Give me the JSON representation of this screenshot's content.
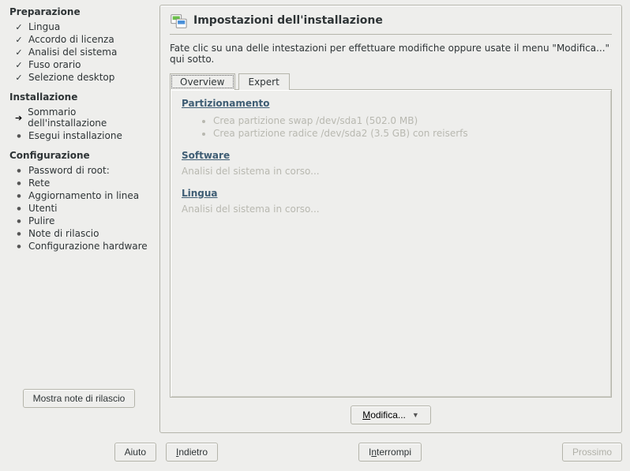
{
  "sidebar": {
    "sections": [
      {
        "title": "Preparazione",
        "items": [
          {
            "label": "Lingua",
            "status": "check"
          },
          {
            "label": "Accordo di licenza",
            "status": "check"
          },
          {
            "label": "Analisi del sistema",
            "status": "check"
          },
          {
            "label": "Fuso orario",
            "status": "check"
          },
          {
            "label": "Selezione desktop",
            "status": "check"
          }
        ]
      },
      {
        "title": "Installazione",
        "items": [
          {
            "label": "Sommario dell'installazione",
            "status": "arrow"
          },
          {
            "label": "Esegui installazione",
            "status": "bullet"
          }
        ]
      },
      {
        "title": "Configurazione",
        "items": [
          {
            "label": "Password di root:",
            "status": "bullet"
          },
          {
            "label": "Rete",
            "status": "bullet"
          },
          {
            "label": "Aggiornamento in linea",
            "status": "bullet"
          },
          {
            "label": "Utenti",
            "status": "bullet"
          },
          {
            "label": "Pulire",
            "status": "bullet"
          },
          {
            "label": "Note di rilascio",
            "status": "bullet"
          },
          {
            "label": "Configurazione hardware",
            "status": "bullet"
          }
        ]
      }
    ],
    "release_notes_button": "Mostra note di rilascio"
  },
  "panel": {
    "title": "Impostazioni dell'installazione",
    "description": "Fate clic su una delle intestazioni per effettuare modifiche oppure usate il menu \"Modifica...\" qui sotto.",
    "tabs": {
      "overview": "Overview",
      "expert": "Expert"
    },
    "sections": {
      "partitioning": {
        "title": "Partizionamento",
        "items": [
          "Crea partizione swap /dev/sda1 (502.0 MB)",
          "Crea partizione radice /dev/sda2 (3.5 GB) con reiserfs"
        ]
      },
      "software": {
        "title": "Software",
        "text": "Analisi del sistema in corso..."
      },
      "language": {
        "title": "Lingua",
        "text": "Analisi del sistema in corso..."
      }
    },
    "modify_button": "Modifica..."
  },
  "footer": {
    "help": "Aiuto",
    "back": "Indietro",
    "abort": "Interrompi",
    "next": "Prossimo"
  }
}
